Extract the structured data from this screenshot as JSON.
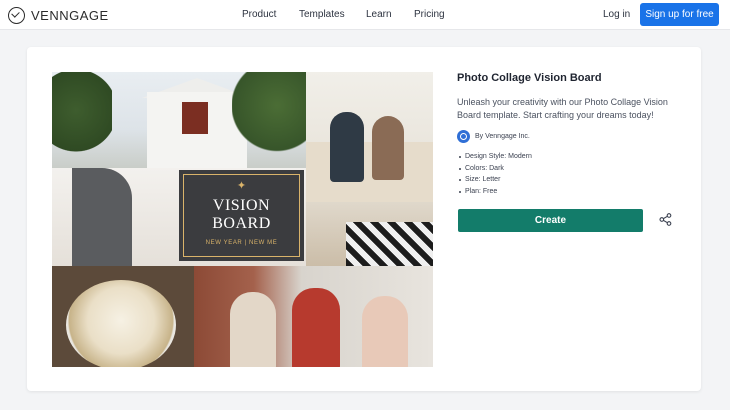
{
  "header": {
    "brand": "VENNGAGE",
    "nav": [
      "Product",
      "Templates",
      "Learn",
      "Pricing"
    ],
    "login": "Log in",
    "signup": "Sign up for free"
  },
  "template": {
    "title": "Photo Collage Vision Board",
    "description": "Unleash your creativity with our Photo Collage Vision Board template. Start crafting your dreams today!",
    "author": "By Venngage Inc.",
    "specs": [
      "Design Style: Modern",
      "Colors: Dark",
      "Size: Letter",
      "Plan: Free"
    ],
    "create_label": "Create"
  },
  "preview": {
    "star": "✦",
    "title_line1": "VISION",
    "title_line2": "BOARD",
    "subtitle": "NEW YEAR | NEW ME"
  },
  "colors": {
    "primary_blue": "#1a73e8",
    "create_green": "#137c6a",
    "gold": "#d9b36a"
  },
  "icons": {
    "logo": "venngage-logo-icon",
    "author": "venngage-avatar-icon",
    "share": "share-icon"
  }
}
